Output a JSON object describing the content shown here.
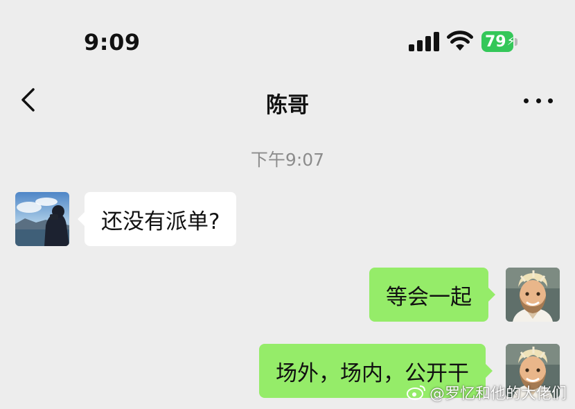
{
  "status_bar": {
    "time": "9:09",
    "battery_level": "79",
    "icons": [
      "signal-icon",
      "wifi-icon",
      "battery-charging-icon"
    ]
  },
  "nav": {
    "title": "陈哥",
    "back_icon": "chevron-left-icon",
    "more_icon": "more-dots-icon"
  },
  "chat": {
    "timestamp": "下午9:07",
    "messages": [
      {
        "side": "left",
        "text": "还没有派单?"
      },
      {
        "side": "right",
        "text": "等会一起"
      },
      {
        "side": "right",
        "text": "场外，场内，公开干"
      }
    ]
  },
  "watermark": {
    "text": "@罗忆和他的大佬们",
    "icon": "weibo-icon"
  },
  "colors": {
    "background": "#ededed",
    "bubble_self": "#95ec69",
    "bubble_other": "#ffffff",
    "battery": "#34c759",
    "timestamp": "#8c8c8c"
  }
}
